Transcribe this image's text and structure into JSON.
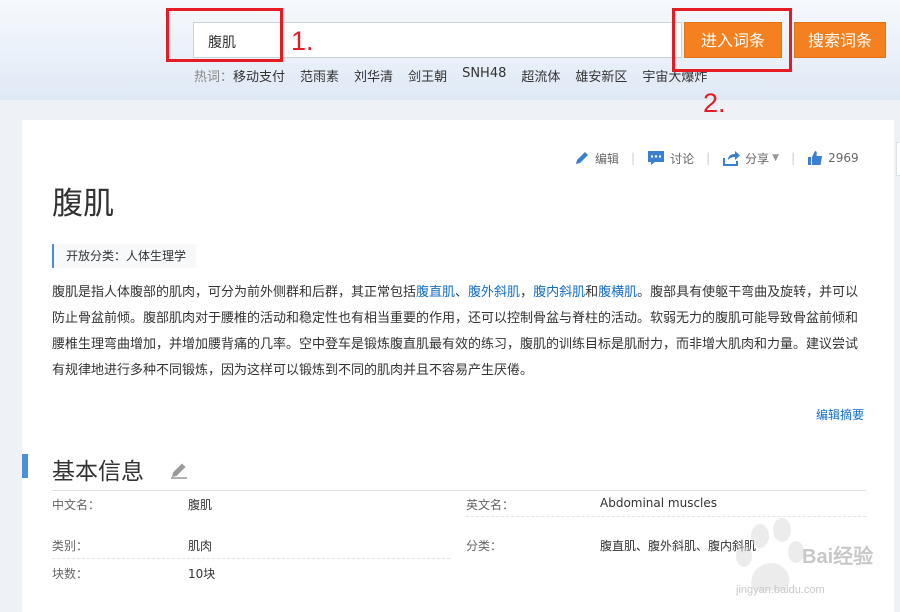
{
  "search": {
    "value": "腹肌",
    "enter_button": "进入词条",
    "search_button": "搜索词条"
  },
  "hotwords": {
    "label": "热词：",
    "items": [
      "移动支付",
      "范雨素",
      "刘华清",
      "剑王朝",
      "SNH48",
      "超流体",
      "雄安新区",
      "宇宙大爆炸"
    ]
  },
  "annotations": {
    "step1": "1.",
    "step2": "2."
  },
  "toolbar": {
    "edit": "编辑",
    "discuss": "讨论",
    "share": "分享",
    "like_count": "2969"
  },
  "page": {
    "title": "腹肌",
    "category": "开放分类：人体生理学"
  },
  "summary": {
    "part1": "腹肌是指人体腹部的肌肉，可分为前外侧群和后群，其正常包括",
    "link1": "腹直肌",
    "sep1": "、",
    "link2": "腹外斜肌",
    "sep2": "，",
    "link3": "腹内斜肌",
    "and": "和",
    "link4": "腹横肌",
    "part2": "。腹部具有使躯干弯曲及旋转，并可以防止骨盆前倾。腹部肌肉对于腰椎的活动和稳定性也有相当重要的作用，还可以控制骨盆与脊柱的活动。软弱无力的腹肌可能导致骨盆前倾和腰椎生理弯曲增加，并增加腰背痛的几率。空中登车是锻炼腹直肌最有效的练习，腹肌的训练目标是肌耐力，而非增大肌肉和力量。建议尝试有规律地进行多种不同锻炼，因为这样可以锻炼到不同的肌肉并且不容易产生厌倦。",
    "edit_link": "编辑摘要"
  },
  "basic_info": {
    "title": "基本信息",
    "rows": [
      {
        "l1": "中文名：",
        "v1": "腹肌",
        "l2": "英文名：",
        "v2": "Abdominal muscles"
      },
      {
        "l1": "类别：",
        "v1": "肌肉",
        "l2": "分类：",
        "v2": "腹直肌、腹外斜肌、腹内斜肌"
      },
      {
        "l1": "块数：",
        "v1": "10块",
        "l2": "",
        "v2": ""
      }
    ]
  },
  "watermark": {
    "text": "Bai经验",
    "url": "jingyan.baidu.com"
  },
  "colors": {
    "accent_orange": "#f4801f",
    "link_blue": "#136ec2",
    "annotation_red": "#e51c23",
    "section_blue": "#4a90d9"
  }
}
